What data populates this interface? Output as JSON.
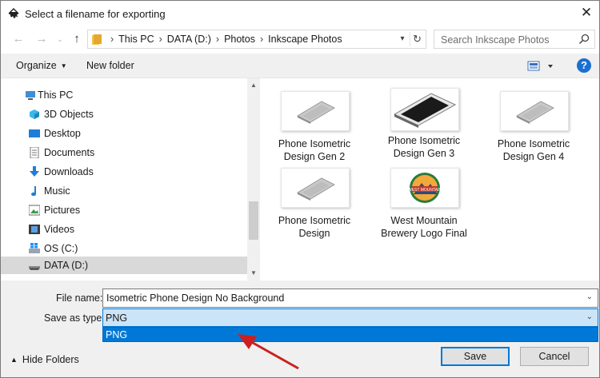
{
  "window": {
    "title": "Select a filename for exporting",
    "close_glyph": "✕"
  },
  "address": {
    "crumbs": [
      "This PC",
      "DATA (D:)",
      "Photos",
      "Inkscape Photos"
    ],
    "separator": "›"
  },
  "search": {
    "placeholder": "Search Inkscape Photos"
  },
  "toolbar": {
    "organize": "Organize",
    "new_folder": "New folder",
    "help": "?"
  },
  "sidebar": {
    "items": [
      {
        "label": "This PC",
        "icon": "computer-icon"
      },
      {
        "label": "3D Objects",
        "icon": "cube-icon"
      },
      {
        "label": "Desktop",
        "icon": "desktop-icon"
      },
      {
        "label": "Documents",
        "icon": "documents-icon"
      },
      {
        "label": "Downloads",
        "icon": "download-icon"
      },
      {
        "label": "Music",
        "icon": "music-icon"
      },
      {
        "label": "Pictures",
        "icon": "pictures-icon"
      },
      {
        "label": "Videos",
        "icon": "videos-icon"
      },
      {
        "label": "OS (C:)",
        "icon": "windows-drive-icon"
      },
      {
        "label": "DATA (D:)",
        "icon": "drive-icon",
        "selected": true
      }
    ]
  },
  "files": [
    {
      "name": "Phone Isometric Design Gen 2"
    },
    {
      "name": "Phone Isometric Design Gen 3"
    },
    {
      "name": "Phone Isometric Design Gen 4"
    },
    {
      "name": "Phone Isometric Design"
    },
    {
      "name": "West Mountain Brewery Logo Final",
      "thumb_text": "WEST MOUNTAIN"
    }
  ],
  "form": {
    "file_name_label": "File name:",
    "file_name_value": "Isometric Phone Design No Background",
    "save_type_label": "Save as type:",
    "save_type_value": "PNG",
    "save_type_options": [
      "PNG"
    ]
  },
  "footer": {
    "hide_folders": "Hide Folders",
    "save": "Save",
    "cancel": "Cancel"
  },
  "colors": {
    "accent": "#0078d7",
    "annotation_arrow": "#cc1f1f",
    "selection_bg": "#cce4f7"
  }
}
